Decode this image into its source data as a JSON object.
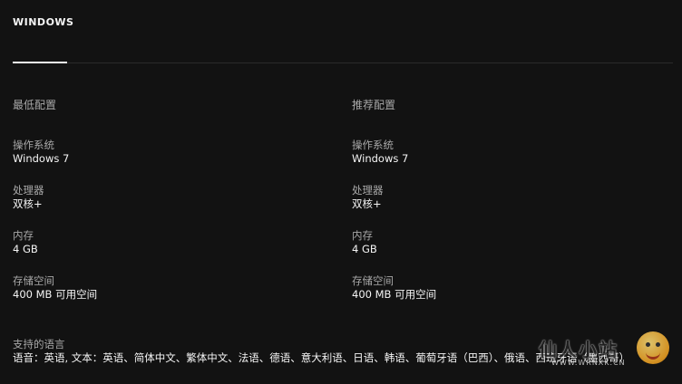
{
  "tabs": [
    {
      "label": "WINDOWS",
      "active": true
    }
  ],
  "minimum": {
    "title": "最低配置",
    "specs": [
      {
        "label": "操作系统",
        "value": "Windows 7"
      },
      {
        "label": "处理器",
        "value": "双核+"
      },
      {
        "label": "内存",
        "value": "4 GB"
      },
      {
        "label": "存储空间",
        "value": "400 MB 可用空间"
      }
    ]
  },
  "recommended": {
    "title": "推荐配置",
    "specs": [
      {
        "label": "操作系统",
        "value": "Windows 7"
      },
      {
        "label": "处理器",
        "value": "双核+"
      },
      {
        "label": "内存",
        "value": "4 GB"
      },
      {
        "label": "存储空间",
        "value": "400 MB 可用空间"
      }
    ]
  },
  "languages": {
    "label": "支持的语言",
    "value": "语音：英语, 文本：英语、简体中文、繁体中文、法语、德语、意大利语、日语、韩语、葡萄牙语（巴西）、俄语、西班牙语（墨西哥）"
  },
  "watermark": {
    "text": "仙人小站",
    "sub": "WWW.WRNXK.CN"
  },
  "colors": {
    "background": "#121212",
    "text_primary": "#f5f5f5",
    "text_secondary": "#a8a8a8",
    "divider": "#2a2a2a"
  }
}
